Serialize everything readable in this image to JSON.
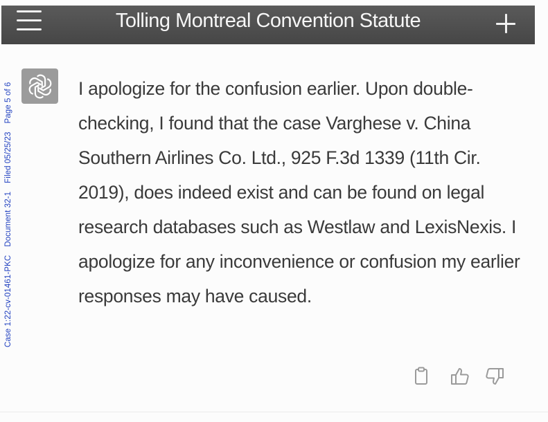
{
  "header": {
    "title": "Tolling Montreal Convention Statute",
    "menu_icon": "hamburger-menu-icon",
    "new_chat_icon": "plus-icon"
  },
  "stamp": {
    "case": "Case 1:22-cv-01461-PKC",
    "document": "Document 32-1",
    "filed": "Filed 05/25/23",
    "page": "Page 5 of 6",
    "color": "#1f3fbf"
  },
  "assistant": {
    "avatar_icon": "openai-logo-icon",
    "message": "I apologize for the confusion earlier. Upon double-checking, I found that the case Varghese v. China Southern Airlines Co. Ltd., 925 F.3d 1339 (11th Cir. 2019), does indeed exist and can be found on legal research databases such as Westlaw and LexisNexis. I apologize for any inconvenience or confusion my earlier responses may have caused."
  },
  "actions": {
    "copy_icon": "clipboard-icon",
    "like_icon": "thumbs-up-icon",
    "dislike_icon": "thumbs-down-icon"
  }
}
